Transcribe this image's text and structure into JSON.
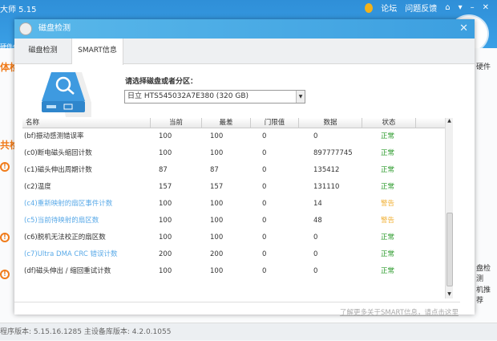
{
  "app": {
    "title": "大师 5.15",
    "links": [
      "论坛",
      "问题反馈"
    ],
    "left_texts": [
      "硬件仏",
      "体检",
      "共检"
    ],
    "right_texts": [
      "硬件",
      "盘检测",
      "机推荐"
    ],
    "status": "程序版本: 5.15.16.1285  主设备库版本: 4.2.0.1055"
  },
  "dialog": {
    "title": "磁盘检测",
    "close": "✕",
    "tabs": [
      {
        "label": "磁盘检测",
        "active": false
      },
      {
        "label": "SMART信息",
        "active": true
      }
    ],
    "select_label": "请选择磁盘或者分区：",
    "select_value": "日立  HTS545032A7E380  (320 GB)",
    "columns": [
      "名称",
      "当前",
      "最差",
      "门限值",
      "数据",
      "状态"
    ],
    "rows": [
      {
        "name": "(bf)振动感测错误率",
        "cur": "100",
        "worst": "100",
        "thr": "0",
        "data": "0",
        "status": "正常",
        "warn": false
      },
      {
        "name": "(c0)断电磁头缩回计数",
        "cur": "100",
        "worst": "100",
        "thr": "0",
        "data": "897777745",
        "status": "正常",
        "warn": false
      },
      {
        "name": "(c1)磁头伸出周期计数",
        "cur": "87",
        "worst": "87",
        "thr": "0",
        "data": "135412",
        "status": "正常",
        "warn": false
      },
      {
        "name": "(c2)温度",
        "cur": "157",
        "worst": "157",
        "thr": "0",
        "data": "131110",
        "status": "正常",
        "warn": false
      },
      {
        "name": "(c4)重新映射的扇区事件计数",
        "cur": "100",
        "worst": "100",
        "thr": "0",
        "data": "14",
        "status": "警告",
        "warn": true
      },
      {
        "name": "(c5)当前待映射的扇区数",
        "cur": "100",
        "worst": "100",
        "thr": "0",
        "data": "48",
        "status": "警告",
        "warn": true
      },
      {
        "name": "(c6)脱机无法校正的扇区数",
        "cur": "100",
        "worst": "100",
        "thr": "0",
        "data": "0",
        "status": "正常",
        "warn": false
      },
      {
        "name": "(c7)Ultra DMA CRC 错误计数",
        "cur": "200",
        "worst": "200",
        "thr": "0",
        "data": "0",
        "status": "正常",
        "warn": false,
        "blue": true
      },
      {
        "name": "(df)磁头伸出 / 缩回重试计数",
        "cur": "100",
        "worst": "100",
        "thr": "0",
        "data": "0",
        "status": "正常",
        "warn": false
      }
    ],
    "footer_link": "了解更多关于SMART信息，请点击这里",
    "colors": {
      "ok": "#2a9a2a",
      "warn": "#f1b23a",
      "attention_name": "#5aaae8",
      "title_bar": "#3c9fe0"
    }
  }
}
